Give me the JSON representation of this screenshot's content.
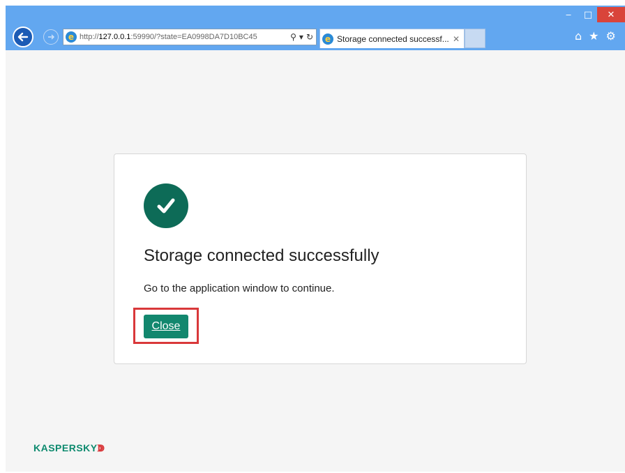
{
  "window": {
    "minimize": "‒",
    "maximize": "□",
    "close": "✕"
  },
  "address_bar": {
    "prefix": "http://",
    "host": "127.0.0.1",
    "rest": ":59990/?state=EA0998DA7D10BC45"
  },
  "tab": {
    "title": "Storage connected successf...",
    "close": "✕"
  },
  "page": {
    "title": "Storage connected successfully",
    "message": "Go to the application window to continue.",
    "close_button": "Close",
    "logo": "KASPERSKY",
    "logo_mark": "ↇ"
  },
  "colors": {
    "accent": "#12876e",
    "check_bg": "#0d6b57",
    "highlight": "#d9383a",
    "chrome": "#62a7f0"
  }
}
